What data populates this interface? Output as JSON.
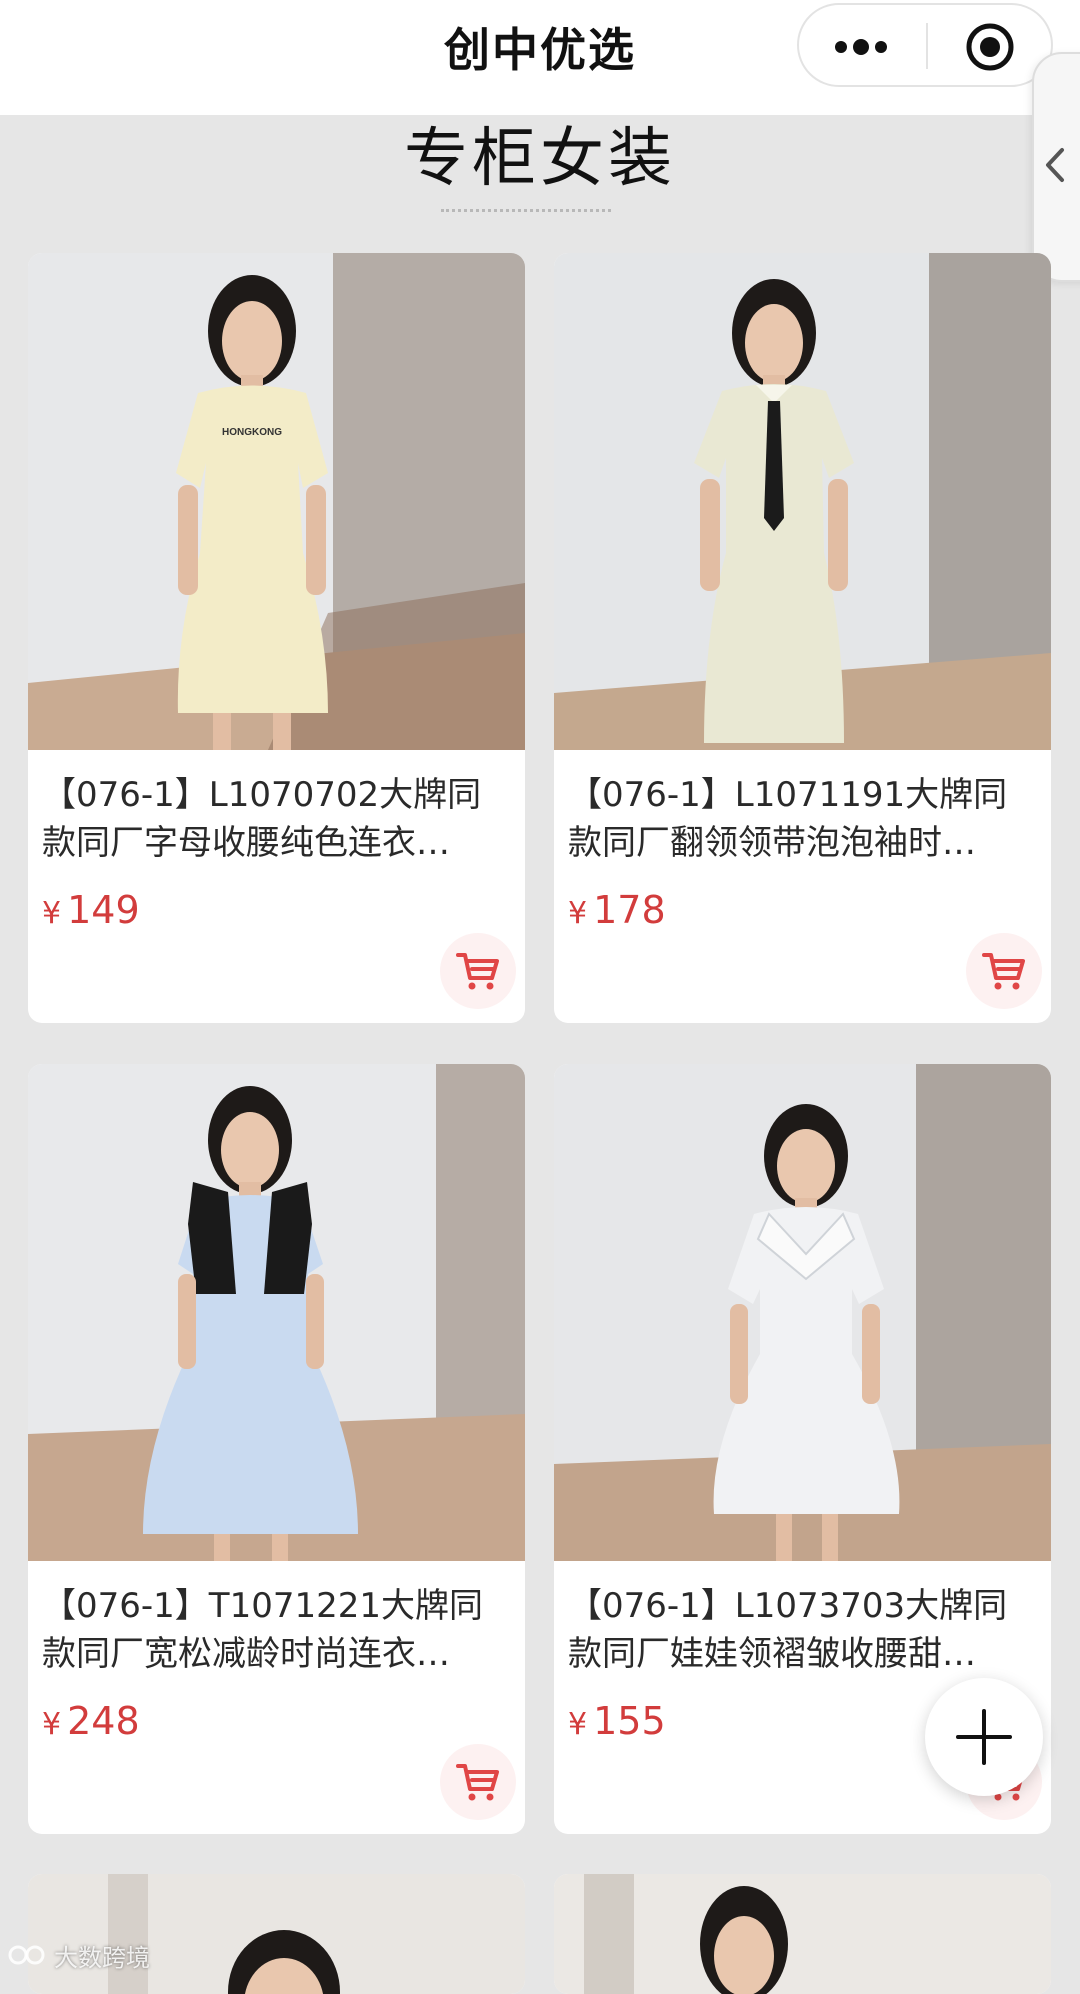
{
  "header": {
    "title": "创中优选",
    "more_icon": "more-dots-icon",
    "close_icon": "target-circle-icon"
  },
  "side_tab": {
    "icon": "chevron-left-icon"
  },
  "section": {
    "title": "专柜女装"
  },
  "products": [
    {
      "name": "【076-1】L1070702大牌同款同厂字母收腰纯色连衣…",
      "currency": "¥",
      "price": "149",
      "photo_label": "HONGKONG"
    },
    {
      "name": "【076-1】L1071191大牌同款同厂翻领领带泡泡袖时…",
      "currency": "¥",
      "price": "178"
    },
    {
      "name": "【076-1】T1071221大牌同款同厂宽松减龄时尚连衣…",
      "currency": "¥",
      "price": "248"
    },
    {
      "name": "【076-1】L1073703大牌同款同厂娃娃领褶皱收腰甜…",
      "currency": "¥",
      "price": "155"
    }
  ],
  "fab": {
    "icon": "plus-icon"
  },
  "watermark": {
    "text": "大数跨境"
  },
  "colors": {
    "price": "#d23c3c",
    "background": "#e6e6e6",
    "card": "#ffffff"
  }
}
